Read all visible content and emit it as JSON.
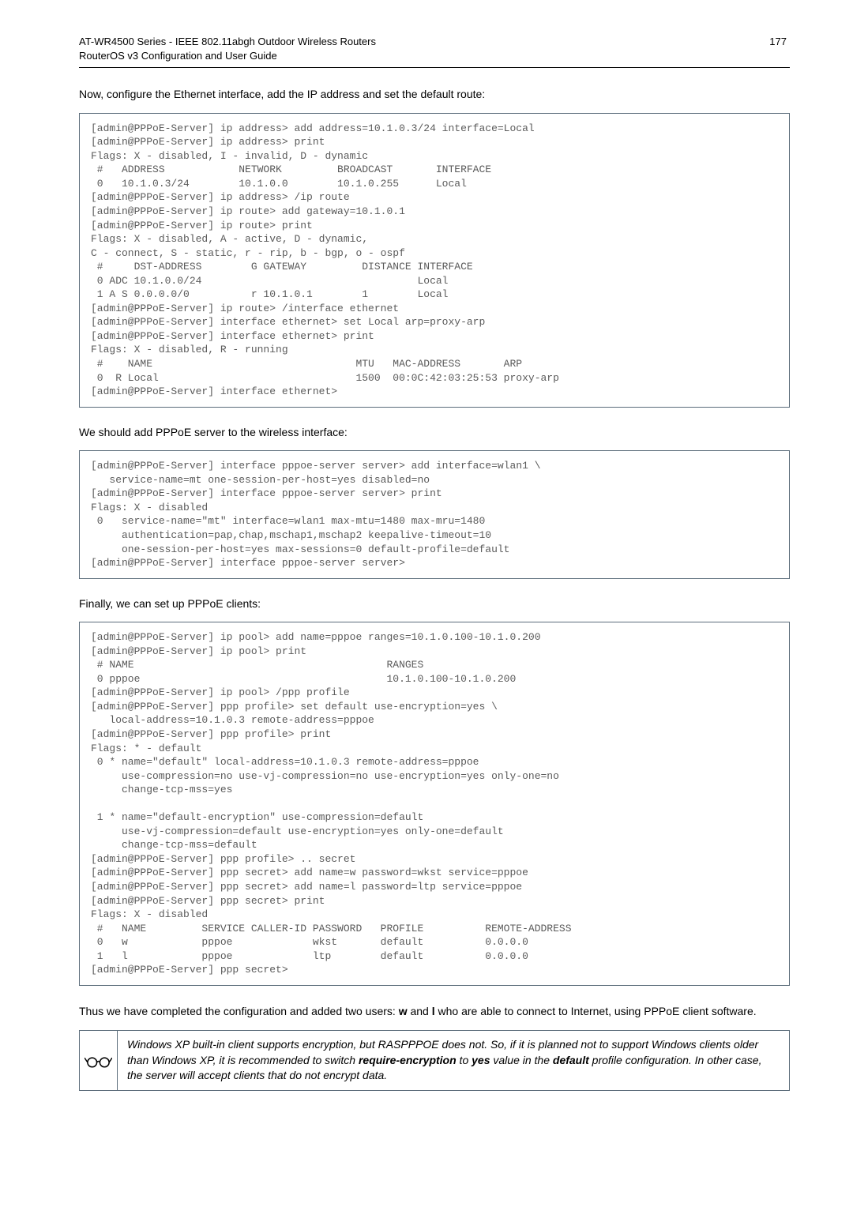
{
  "header": {
    "title_line1": "AT-WR4500 Series - IEEE 802.11abgh Outdoor Wireless Routers",
    "title_line2": "RouterOS v3 Configuration and User Guide",
    "page_number": "177"
  },
  "section1": {
    "intro": "Now, configure the Ethernet interface, add the IP address and set the default route:",
    "code": "[admin@PPPoE-Server] ip address> add address=10.1.0.3/24 interface=Local\n[admin@PPPoE-Server] ip address> print\nFlags: X - disabled, I - invalid, D - dynamic\n #   ADDRESS            NETWORK         BROADCAST       INTERFACE\n 0   10.1.0.3/24        10.1.0.0        10.1.0.255      Local\n[admin@PPPoE-Server] ip address> /ip route\n[admin@PPPoE-Server] ip route> add gateway=10.1.0.1\n[admin@PPPoE-Server] ip route> print\nFlags: X - disabled, A - active, D - dynamic,\nC - connect, S - static, r - rip, b - bgp, o - ospf\n #     DST-ADDRESS        G GATEWAY         DISTANCE INTERFACE\n 0 ADC 10.1.0.0/24                                   Local\n 1 A S 0.0.0.0/0          r 10.1.0.1        1        Local\n[admin@PPPoE-Server] ip route> /interface ethernet\n[admin@PPPoE-Server] interface ethernet> set Local arp=proxy-arp\n[admin@PPPoE-Server] interface ethernet> print\nFlags: X - disabled, R - running\n #    NAME                                 MTU   MAC-ADDRESS       ARP\n 0  R Local                                1500  00:0C:42:03:25:53 proxy-arp\n[admin@PPPoE-Server] interface ethernet>"
  },
  "section2": {
    "intro": "We should add PPPoE server to the wireless interface:",
    "code": "[admin@PPPoE-Server] interface pppoe-server server> add interface=wlan1 \\\n   service-name=mt one-session-per-host=yes disabled=no\n[admin@PPPoE-Server] interface pppoe-server server> print\nFlags: X - disabled\n 0   service-name=\"mt\" interface=wlan1 max-mtu=1480 max-mru=1480\n     authentication=pap,chap,mschap1,mschap2 keepalive-timeout=10\n     one-session-per-host=yes max-sessions=0 default-profile=default\n[admin@PPPoE-Server] interface pppoe-server server>"
  },
  "section3": {
    "intro": "Finally, we can set up PPPoE clients:",
    "code": "[admin@PPPoE-Server] ip pool> add name=pppoe ranges=10.1.0.100-10.1.0.200\n[admin@PPPoE-Server] ip pool> print\n # NAME                                         RANGES\n 0 pppoe                                        10.1.0.100-10.1.0.200\n[admin@PPPoE-Server] ip pool> /ppp profile\n[admin@PPPoE-Server] ppp profile> set default use-encryption=yes \\\n   local-address=10.1.0.3 remote-address=pppoe\n[admin@PPPoE-Server] ppp profile> print\nFlags: * - default\n 0 * name=\"default\" local-address=10.1.0.3 remote-address=pppoe\n     use-compression=no use-vj-compression=no use-encryption=yes only-one=no\n     change-tcp-mss=yes\n\n 1 * name=\"default-encryption\" use-compression=default\n     use-vj-compression=default use-encryption=yes only-one=default\n     change-tcp-mss=default\n[admin@PPPoE-Server] ppp profile> .. secret\n[admin@PPPoE-Server] ppp secret> add name=w password=wkst service=pppoe\n[admin@PPPoE-Server] ppp secret> add name=l password=ltp service=pppoe\n[admin@PPPoE-Server] ppp secret> print\nFlags: X - disabled\n #   NAME         SERVICE CALLER-ID PASSWORD   PROFILE          REMOTE-ADDRESS\n 0   w            pppoe             wkst       default          0.0.0.0\n 1   l            pppoe             ltp        default          0.0.0.0\n[admin@PPPoE-Server] ppp secret>"
  },
  "closing": {
    "text_before_bold1": "Thus we have completed the configuration and added two users: ",
    "bold1": "w",
    "mid": " and ",
    "bold2": "l",
    "text_after": " who are able to connect to Internet, using PPPoE client software."
  },
  "note": {
    "p1a": "Windows XP built-in client supports encryption, but RASPPPOE does not. So, if it is planned not to support Windows clients older than Windows XP, it is recommended to switch ",
    "b1": "require-encryption",
    "p1b": " to ",
    "b2": "yes",
    "p1c": " value in the ",
    "b3": "default",
    "p1d": " profile configuration. In other case, the server will accept clients that do not encrypt data."
  }
}
